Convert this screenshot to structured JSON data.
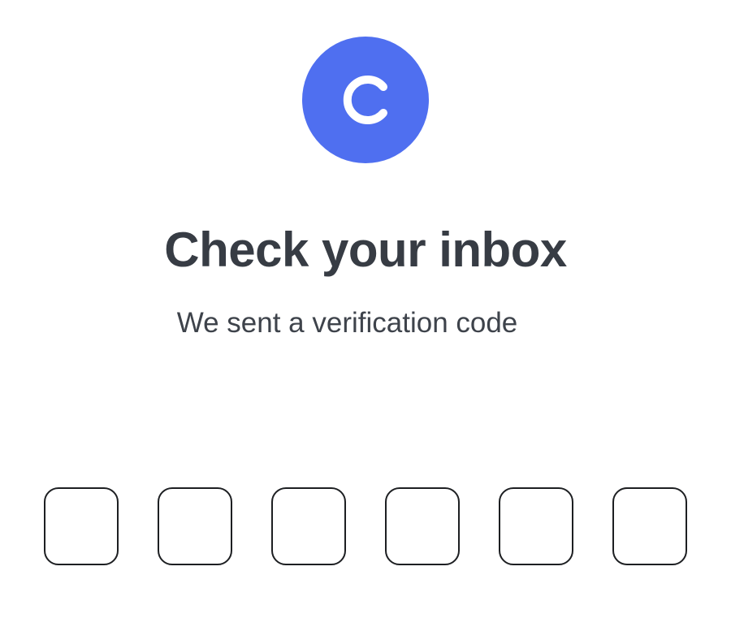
{
  "brand": {
    "logo_icon": "c-letter-logo-icon",
    "logo_color": "#4f6ff0"
  },
  "header": {
    "title": "Check your inbox",
    "subtitle": "We sent a verification code"
  },
  "code": {
    "digits": [
      "",
      "",
      "",
      "",
      "",
      ""
    ]
  },
  "colors": {
    "text_primary": "#373c44",
    "box_border": "#1d1f22"
  }
}
